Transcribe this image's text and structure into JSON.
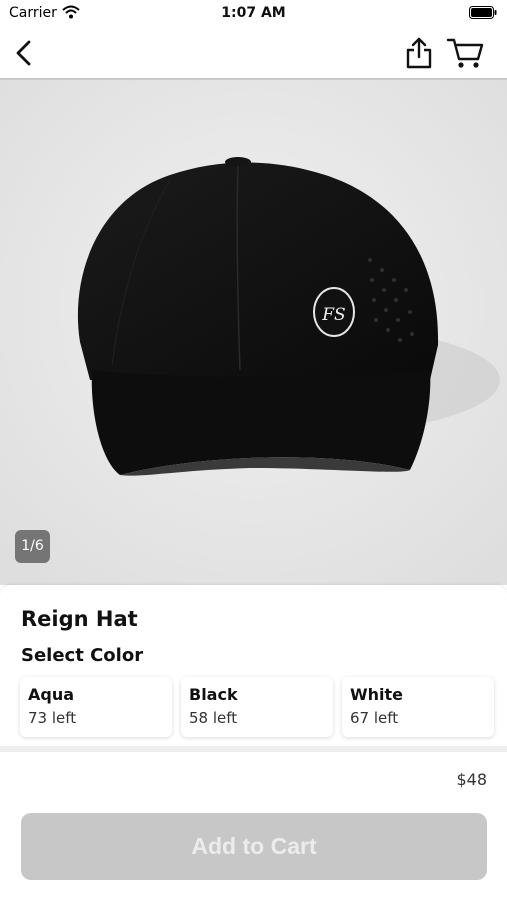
{
  "status_bar": {
    "carrier": "Carrier",
    "time": "1:07 AM"
  },
  "nav": {
    "back_icon": "chevron-left-icon",
    "share_icon": "share-icon",
    "cart_icon": "cart-icon"
  },
  "gallery": {
    "page_indicator": "1/6",
    "logo_text": "FS"
  },
  "product": {
    "title": "Reign Hat",
    "select_color_label": "Select Color",
    "colors": [
      {
        "name": "Aqua",
        "stock": "73 left"
      },
      {
        "name": "Black",
        "stock": "58 left"
      },
      {
        "name": "White",
        "stock": "67 left"
      }
    ],
    "price": "$48"
  },
  "footer": {
    "add_to_cart_label": "Add to Cart"
  },
  "theme": {
    "button_disabled_bg": "#c7c7c7",
    "hero_bg": "#e9e9ea"
  }
}
